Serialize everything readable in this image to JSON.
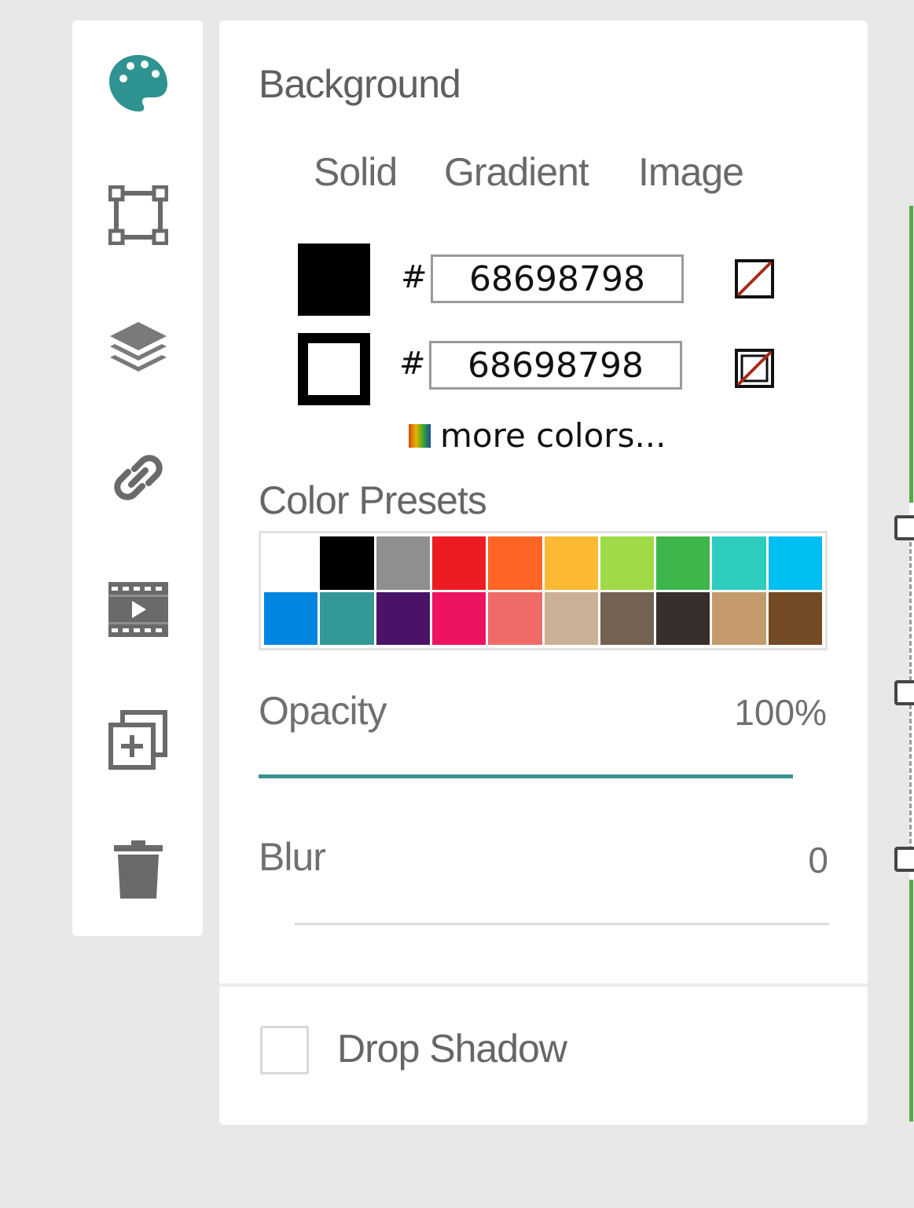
{
  "toolbar": {
    "tools": [
      {
        "name": "palette-icon",
        "color": "#2f9391"
      },
      {
        "name": "transform-icon",
        "color": "#6a6a6a"
      },
      {
        "name": "layers-icon",
        "color": "#6a6a6a"
      },
      {
        "name": "link-icon",
        "color": "#6a6a6a"
      },
      {
        "name": "video-icon",
        "color": "#6a6a6a"
      },
      {
        "name": "duplicate-icon",
        "color": "#6a6a6a"
      },
      {
        "name": "trash-icon",
        "color": "#6a6a6a"
      }
    ]
  },
  "background": {
    "title": "Background",
    "tabs": [
      "Solid",
      "Gradient",
      "Image"
    ],
    "fill": {
      "hash": "#",
      "value": "68698798",
      "swatch_color": "#000000"
    },
    "stroke": {
      "hash": "#",
      "value": "68698798",
      "swatch_color": "#000000"
    },
    "more_colors": "more colors..."
  },
  "presets": {
    "title": "Color Presets",
    "colors": [
      "#ffffff",
      "#000000",
      "#8f8f8f",
      "#ed1c24",
      "#ff6524",
      "#fbb934",
      "#9fdb47",
      "#3db54a",
      "#2ecbbf",
      "#00bdf2",
      "#0086e0",
      "#339896",
      "#4a1368",
      "#ed1362",
      "#ee6b68",
      "#c9b097",
      "#746352",
      "#382e2b",
      "#c49a6c",
      "#744b24"
    ]
  },
  "opacity": {
    "label": "Opacity",
    "value": "100%",
    "level": 1.0,
    "track_color": "#3a9190"
  },
  "blur": {
    "label": "Blur",
    "value": "0",
    "level": 0
  },
  "drop_shadow": {
    "label": "Drop Shadow",
    "checked": false
  }
}
